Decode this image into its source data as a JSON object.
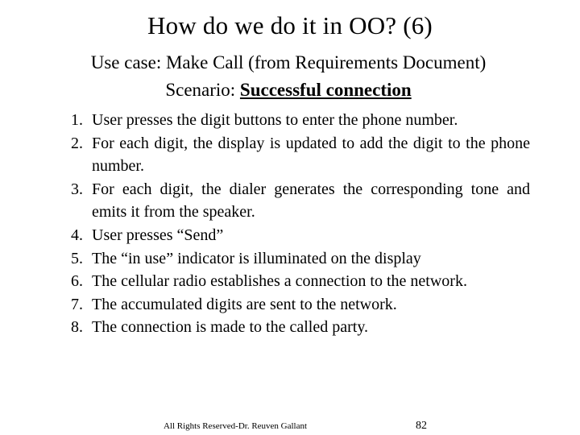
{
  "slide": {
    "title": "How do we do it in OO? (6)",
    "use_case_line": "Use case: Make Call (from Requirements Document)",
    "scenario_label": "Scenario: ",
    "scenario_value": "Successful connection",
    "steps": [
      {
        "number": "1.",
        "text": "User presses the digit buttons to enter the phone number."
      },
      {
        "number": "2.",
        "text": "For each digit, the display is updated to add the digit to the  phone number."
      },
      {
        "number": "3.",
        "text": "For each digit, the dialer generates the corresponding tone and  emits it from the speaker."
      },
      {
        "number": "4.",
        "text": "User presses “Send”"
      },
      {
        "number": "5.",
        "text": "The “in use” indicator is illuminated on the display"
      },
      {
        "number": "6.",
        "text": "The cellular radio establishes a connection to the network."
      },
      {
        "number": "7.",
        "text": "The accumulated digits are sent to the network."
      },
      {
        "number": "8.",
        "text": "The connection is made to the called party."
      }
    ],
    "footer_note": "All Rights Reserved-Dr. Reuven Gallant",
    "page_number": "82"
  },
  "colors": {
    "background": "#ffffff",
    "text": "#000000"
  }
}
